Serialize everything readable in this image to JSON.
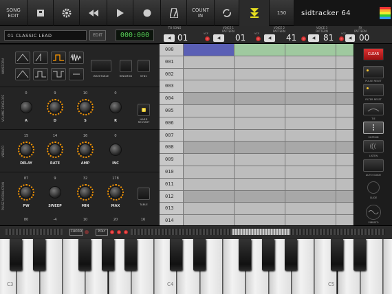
{
  "toolbar": {
    "song_edit": "SONG\nEDIT",
    "count_in": "COUNT\nIN",
    "tempo": "150",
    "brand": "sidtracker 64"
  },
  "instrument": {
    "name": "01  CLASSIC LEAD",
    "edit_label": "EDIT",
    "timer": "000:000"
  },
  "tracks": [
    {
      "header": "TO SONG",
      "value": "01",
      "vcf": ""
    },
    {
      "header": "VOICE 1\nPATTERN",
      "value": "01",
      "vcf": "VCF"
    },
    {
      "header": "VOICE 2\nPATTERN",
      "value": "41",
      "vcf": "VCF"
    },
    {
      "header": "VOICE 3\nPATTERN",
      "value": "81",
      "vcf": "VCF"
    },
    {
      "header": "FX\nPATTERN",
      "value": "00",
      "vcf": ""
    }
  ],
  "waveform": {
    "label": "WAVEFORM",
    "wavetable": "WAVETABLE",
    "ringmod": "RINGMOD",
    "sync": "SYNC"
  },
  "volume_envelope": {
    "label": "VOLUME ENVELOPE",
    "knobs": [
      {
        "label": "A",
        "value": "0"
      },
      {
        "label": "D",
        "value": "9"
      },
      {
        "label": "S",
        "value": "10"
      },
      {
        "label": "R",
        "value": "0"
      }
    ],
    "hard_restart": "HARD\nRESTART"
  },
  "vibrato": {
    "label": "VIBRATO",
    "knobs": [
      {
        "label": "DELAY",
        "value": "15"
      },
      {
        "label": "RATE",
        "value": "14"
      },
      {
        "label": "AMP",
        "value": "16"
      },
      {
        "label": "INC",
        "value": "0"
      }
    ]
  },
  "pulse_modulation": {
    "label": "PULSE MODULATION",
    "knobs": [
      {
        "label": "PW",
        "value": "87"
      },
      {
        "label": "SWEEP",
        "value": "9"
      },
      {
        "label": "MIN",
        "value": "32"
      },
      {
        "label": "MAX",
        "value": "178"
      }
    ],
    "table": "TABLE",
    "next_values": [
      "80",
      "-4",
      "10",
      "20",
      "16"
    ]
  },
  "rows": [
    "000",
    "001",
    "002",
    "003",
    "004",
    "005",
    "006",
    "007",
    "008",
    "009",
    "010",
    "011",
    "012",
    "013",
    "014"
  ],
  "sidebar": {
    "clear": "CLEAR",
    "items": [
      "PULSE RESET",
      "FILTER RESET",
      "TIE",
      "SUSTAIN",
      "LISTEN",
      "AUTO GUIDE",
      "GLIDE",
      "VIBRATO"
    ]
  },
  "keyboard": {
    "chord": "CHORD",
    "poly": "POLY",
    "octaves": [
      "C3",
      "C4",
      "C5"
    ]
  }
}
